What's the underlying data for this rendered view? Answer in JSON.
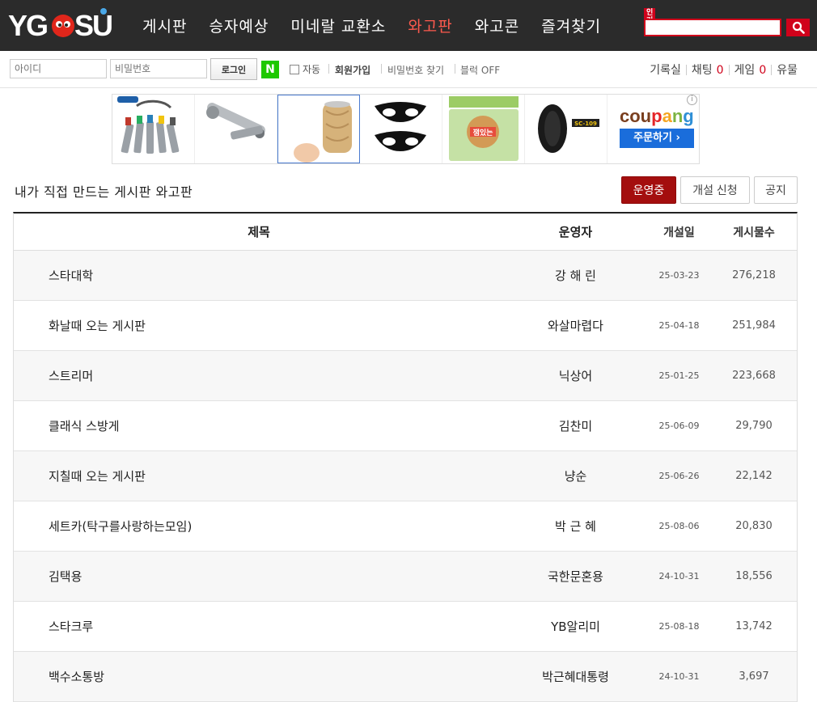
{
  "logo": {
    "text": "YGOSU"
  },
  "nav": {
    "items": [
      {
        "label": "게시판",
        "active": false
      },
      {
        "label": "승자예상",
        "active": false
      },
      {
        "label": "미네랄 교환소",
        "active": false
      },
      {
        "label": "와고판",
        "active": true
      },
      {
        "label": "와고콘",
        "active": false
      },
      {
        "label": "즐겨찾기",
        "active": false
      }
    ],
    "popular_badge": "인기",
    "search_value": "",
    "accent_color": "#d0021b"
  },
  "login": {
    "id_placeholder": "아이디",
    "pw_placeholder": "비밀번호",
    "login_label": "로그인",
    "naver_label": "N",
    "auto_label": "자동",
    "signup_label": "회원가입",
    "find_pw_label": "비밀번호 찾기",
    "block_label": "블럭 OFF",
    "right": {
      "record_label": "기록실",
      "chat_label": "채팅",
      "chat_count": "0",
      "game_label": "게임",
      "game_count": "0",
      "paid_label": "유물"
    }
  },
  "ads": {
    "coupang_logo": "coupang",
    "coupang_button": "주문하기 ›",
    "info_icon": "i",
    "items": [
      "wrench-set-ad",
      "screwdriver-ad",
      "wood-tumbler-ad",
      "cartoon-eyes-ad",
      "snack-bread-ad",
      "tire-ad"
    ],
    "snack_text": "잼있는",
    "tire_text": "SC-109"
  },
  "board": {
    "title": "내가 직접 만드는 게시판 와고판",
    "buttons": {
      "running": "운영중",
      "open_request": "개설 신청",
      "notice": "공지"
    },
    "columns": {
      "title": "제목",
      "operator": "운영자",
      "created": "개설일",
      "posts": "게시물수"
    },
    "rows": [
      {
        "title": "스타대학",
        "operator": "강 해 린",
        "created": "25-03-23",
        "posts": "276,218"
      },
      {
        "title": "화날때 오는 게시판",
        "operator": "와살마렵다",
        "created": "25-04-18",
        "posts": "251,984"
      },
      {
        "title": "스트리머",
        "operator": "닉상어",
        "created": "25-01-25",
        "posts": "223,668"
      },
      {
        "title": "클래식 스방게",
        "operator": "김찬미",
        "created": "25-06-09",
        "posts": "29,790"
      },
      {
        "title": "지칠때 오는 게시판",
        "operator": "냥순",
        "created": "25-06-26",
        "posts": "22,142"
      },
      {
        "title": "세트카(탁구를사랑하는모임)",
        "operator": "박 근 혜",
        "created": "25-08-06",
        "posts": "20,830"
      },
      {
        "title": "김택용",
        "operator": "국한문혼용",
        "created": "24-10-31",
        "posts": "18,556"
      },
      {
        "title": "스타크루",
        "operator": "YB알리미",
        "created": "25-08-18",
        "posts": "13,742"
      },
      {
        "title": "백수소통방",
        "operator": "박근혜대통령",
        "created": "24-10-31",
        "posts": "3,697"
      }
    ]
  }
}
